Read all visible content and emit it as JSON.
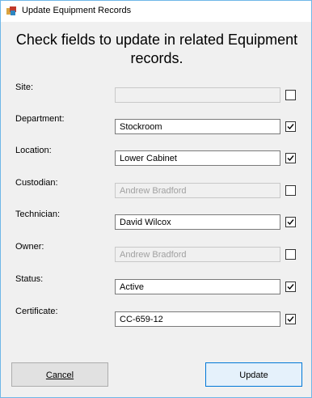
{
  "window": {
    "title": "Update Equipment Records"
  },
  "heading": "Check fields to update in related Equipment records.",
  "fields": [
    {
      "label": "Site:",
      "value": "",
      "enabled": false,
      "checked": false
    },
    {
      "label": "Department:",
      "value": "Stockroom",
      "enabled": true,
      "checked": true
    },
    {
      "label": "Location:",
      "value": "Lower Cabinet",
      "enabled": true,
      "checked": true
    },
    {
      "label": "Custodian:",
      "value": "Andrew Bradford",
      "enabled": false,
      "checked": false
    },
    {
      "label": "Technician:",
      "value": "David Wilcox",
      "enabled": true,
      "checked": true
    },
    {
      "label": "Owner:",
      "value": "Andrew Bradford",
      "enabled": false,
      "checked": false
    },
    {
      "label": "Status:",
      "value": "Active",
      "enabled": true,
      "checked": true
    },
    {
      "label": "Certificate:",
      "value": "CC-659-12",
      "enabled": true,
      "checked": true
    }
  ],
  "buttons": {
    "cancel_label": "Cancel",
    "update_label": "Update"
  },
  "colors": {
    "window_border": "#6fb7e8",
    "default_button_border": "#0078d7"
  }
}
